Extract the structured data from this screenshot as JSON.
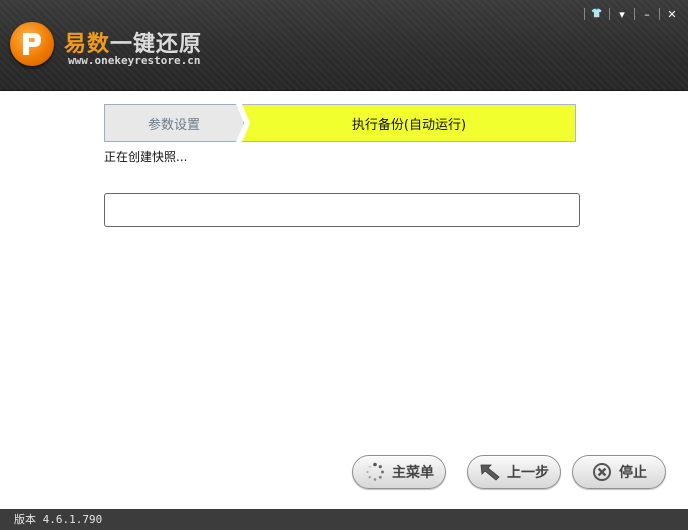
{
  "header": {
    "brand_part1": "易数",
    "brand_part2": "一键还原",
    "site": "www.onekeyrestore.cn",
    "controls": {
      "skin": "👕",
      "menu": "▾",
      "minimize": "–",
      "close": "✕"
    }
  },
  "steps": {
    "step1": "参数设置",
    "step2": "执行备份(自动运行)"
  },
  "status_text": "正在创建快照...",
  "progress": {
    "value": 0
  },
  "buttons": {
    "main_menu": "主菜单",
    "prev": "上一步",
    "stop": "停止"
  },
  "footer": {
    "version": "版本 4.6.1.790"
  },
  "colors": {
    "active_step": "#f2ff2e",
    "brand_orange": "#f39a1e"
  }
}
